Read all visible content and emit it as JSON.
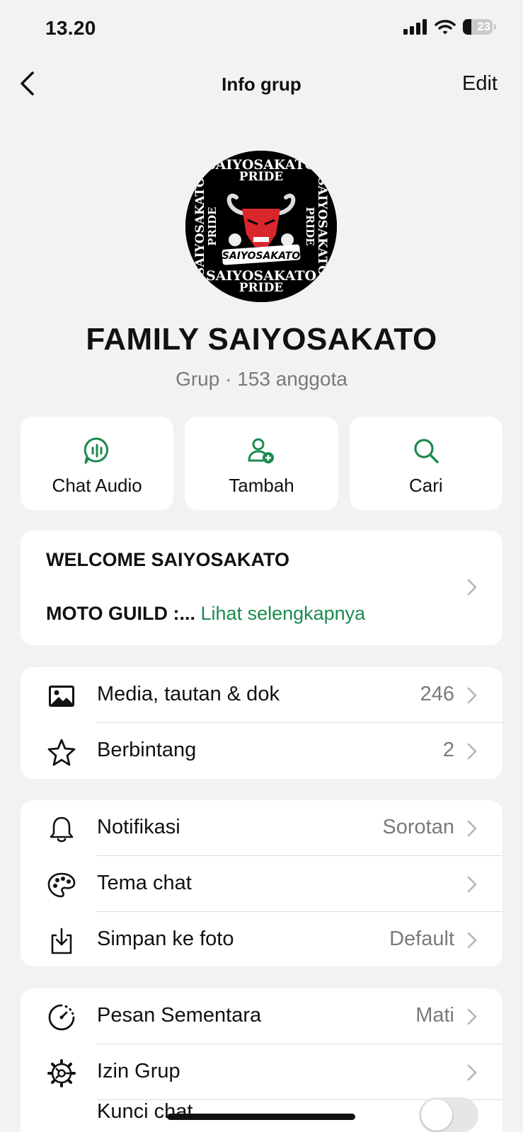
{
  "status_bar": {
    "time": "13.20",
    "battery": "23"
  },
  "nav": {
    "title": "Info grup",
    "edit_label": "Edit"
  },
  "group": {
    "name": "FAMILY SAIYOSAKATO",
    "subtitle": "Grup · 153 anggota",
    "logo_text": [
      "SAIYOSAKATO",
      "PRIDE"
    ]
  },
  "actions": [
    {
      "label": "Chat Audio",
      "icon": "audio-chat-icon"
    },
    {
      "label": "Tambah",
      "icon": "add-person-icon"
    },
    {
      "label": "Cari",
      "icon": "search-icon"
    }
  ],
  "description": {
    "line1": "WELCOME SAIYOSAKATO",
    "line2": "MOTO GUILD :...",
    "more": "Lihat selengkapnya"
  },
  "media_section": [
    {
      "label": "Media, tautan & dok",
      "value": "246",
      "icon": "image-icon"
    },
    {
      "label": "Berbintang",
      "value": "2",
      "icon": "star-icon"
    }
  ],
  "settings_section": [
    {
      "label": "Notifikasi",
      "value": "Sorotan",
      "icon": "bell-icon"
    },
    {
      "label": "Tema chat",
      "value": "",
      "icon": "palette-icon"
    },
    {
      "label": "Simpan ke foto",
      "value": "Default",
      "icon": "download-icon"
    }
  ],
  "misc_section": [
    {
      "label": "Pesan Sementara",
      "value": "Mati",
      "icon": "timer-icon"
    },
    {
      "label": "Izin Grup",
      "value": "",
      "icon": "gear-icon"
    },
    {
      "label": "Kunci chat",
      "value": "",
      "icon": "lock-icon",
      "toggle": false
    }
  ],
  "colors": {
    "accent": "#1c8a4e",
    "background": "#f2f2f1",
    "card": "#ffffff",
    "secondary_text": "#7a7a7a"
  }
}
